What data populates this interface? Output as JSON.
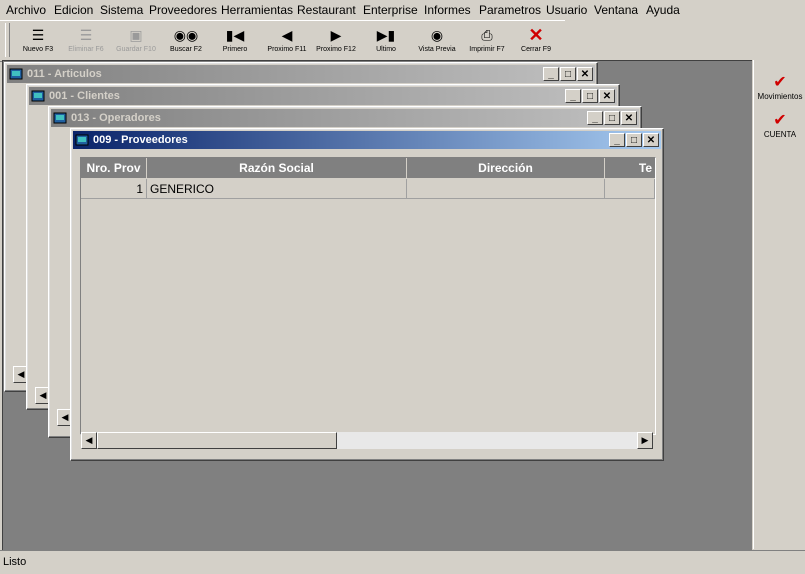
{
  "menu": [
    "Archivo",
    "Edicion",
    "Sistema",
    "Proveedores",
    "Herramientas",
    "Restaurant",
    "Enterprise",
    "Informes",
    "Parametros",
    "Usuario",
    "Ventana",
    "Ayuda"
  ],
  "toolbar": [
    {
      "label": "Nuevo F3",
      "icon": "new-icon",
      "enabled": true
    },
    {
      "label": "Eliminar F6",
      "icon": "delete-icon",
      "enabled": false
    },
    {
      "label": "Guardar F10",
      "icon": "save-icon",
      "enabled": false
    },
    {
      "label": "Buscar F2",
      "icon": "binoculars-icon",
      "enabled": true
    },
    {
      "label": "Primero",
      "icon": "first-icon",
      "enabled": true
    },
    {
      "label": "Proximo F11",
      "icon": "prev-icon",
      "enabled": true
    },
    {
      "label": "Proximo F12",
      "icon": "next-icon",
      "enabled": true
    },
    {
      "label": "Ultimo",
      "icon": "last-icon",
      "enabled": true
    },
    {
      "label": "Vista Previa",
      "icon": "preview-icon",
      "enabled": true
    },
    {
      "label": "Imprimir F7",
      "icon": "printer-icon",
      "enabled": true
    },
    {
      "label": "Cerrar F9",
      "icon": "close-x-icon",
      "enabled": true
    }
  ],
  "windows": {
    "articulos": {
      "title": "011 - Articulos"
    },
    "clientes": {
      "title": "001 - Clientes"
    },
    "operadores": {
      "title": "013 - Operadores"
    },
    "proveedores": {
      "title": "009 - Proveedores"
    }
  },
  "grid": {
    "columns": [
      "Nro. Prov",
      "Razón Social",
      "Dirección",
      "Te"
    ],
    "rows": [
      [
        "1",
        "GENERICO",
        "",
        ""
      ]
    ]
  },
  "right_panel": [
    {
      "label": "Movimientos",
      "icon": "checkmark-icon"
    },
    {
      "label": "CUENTA",
      "icon": "checkmark-icon"
    }
  ],
  "status": {
    "text": "Listo"
  },
  "colors": {
    "active_title": "#0a246a",
    "inactive_title": "#808080",
    "mdi_background": "#808080",
    "close_red": "#d00000"
  }
}
